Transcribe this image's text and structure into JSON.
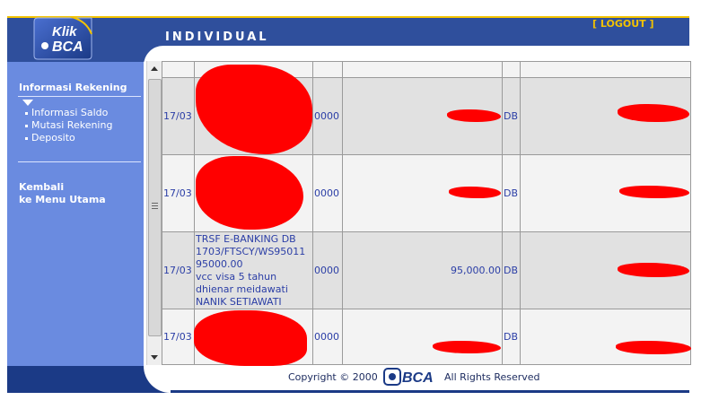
{
  "header": {
    "title": "INDIVIDUAL",
    "logout_label": "[ LOGOUT ]",
    "logo": {
      "top_text": "Klik",
      "bottom_text": "BCA"
    }
  },
  "sidebar": {
    "section_title": "Informasi Rekening",
    "items": [
      {
        "label": "Informasi Saldo"
      },
      {
        "label": "Mutasi Rekening"
      },
      {
        "label": "Deposito"
      }
    ],
    "back_line1": "Kembali",
    "back_line2": "ke Menu Utama"
  },
  "transactions": [
    {
      "date": "17/03",
      "description": [],
      "branch": "0000",
      "amount": "",
      "type": "DB",
      "balance": ""
    },
    {
      "date": "17/03",
      "description": [],
      "branch": "0000",
      "amount": "",
      "type": "DB",
      "balance": ""
    },
    {
      "date": "17/03",
      "description": [
        "TRSF E-BANKING DB",
        "1703/FTSCY/WS95011",
        "95000.00",
        "vcc visa 5 tahun",
        "dhienar meidawati",
        "NANIK SETIAWATI"
      ],
      "branch": "0000",
      "amount": "95,000.00",
      "type": "DB",
      "balance": ""
    },
    {
      "date": "17/03",
      "description": [],
      "branch": "0000",
      "amount": "",
      "type": "DB",
      "balance": ""
    }
  ],
  "footer": {
    "copyright": "Copyright © 2000",
    "logo_text": "BCA",
    "rights": "All Rights Reserved"
  },
  "colors": {
    "header_blue": "#2f4f9c",
    "sidebar_blue": "#6a8be0",
    "accent_yellow": "#f2c200",
    "table_text": "#2b3ea6",
    "redaction": "#ff0000"
  }
}
